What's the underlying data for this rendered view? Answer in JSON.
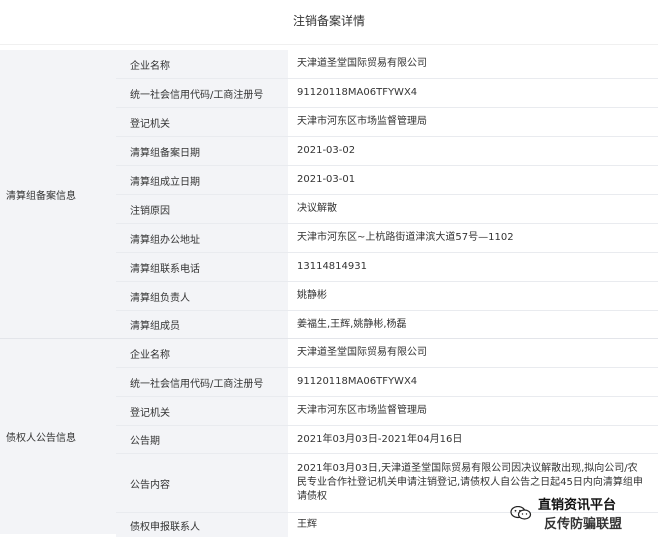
{
  "page": {
    "title": "注销备案详情"
  },
  "sections": [
    {
      "label": "清算组备案信息",
      "rows": [
        {
          "key": "企业名称",
          "value": "天津道圣堂国际贸易有限公司"
        },
        {
          "key": "统一社会信用代码/工商注册号",
          "value": "91120118MA06TFYWX4"
        },
        {
          "key": "登记机关",
          "value": "天津市河东区市场监督管理局"
        },
        {
          "key": "清算组备案日期",
          "value": "2021-03-02"
        },
        {
          "key": "清算组成立日期",
          "value": "2021-03-01"
        },
        {
          "key": "注销原因",
          "value": "决议解散"
        },
        {
          "key": "清算组办公地址",
          "value": "天津市河东区~上杭路街道津滨大道57号—1102"
        },
        {
          "key": "清算组联系电话",
          "value": "13114814931"
        },
        {
          "key": "清算组负责人",
          "value": "姚静彬"
        },
        {
          "key": "清算组成员",
          "value": "姜福生,王辉,姚静彬,杨磊"
        }
      ]
    },
    {
      "label": "债权人公告信息",
      "rows": [
        {
          "key": "企业名称",
          "value": "天津道圣堂国际贸易有限公司"
        },
        {
          "key": "统一社会信用代码/工商注册号",
          "value": "91120118MA06TFYWX4"
        },
        {
          "key": "登记机关",
          "value": "天津市河东区市场监督管理局"
        },
        {
          "key": "公告期",
          "value": "2021年03月03日-2021年04月16日"
        },
        {
          "key": "公告内容",
          "value": "2021年03月03日,天津道圣堂国际贸易有限公司因决议解散出现,拟向公司/农民专业合作社登记机关申请注销登记,请债权人自公告之日起45日内向清算组申请债权"
        },
        {
          "key": "债权申报联系人",
          "value": "王辉"
        }
      ]
    }
  ],
  "watermark": {
    "line1": "直销资讯平台",
    "line2": "反传防骗联盟",
    "icon": "wechat-icon"
  }
}
